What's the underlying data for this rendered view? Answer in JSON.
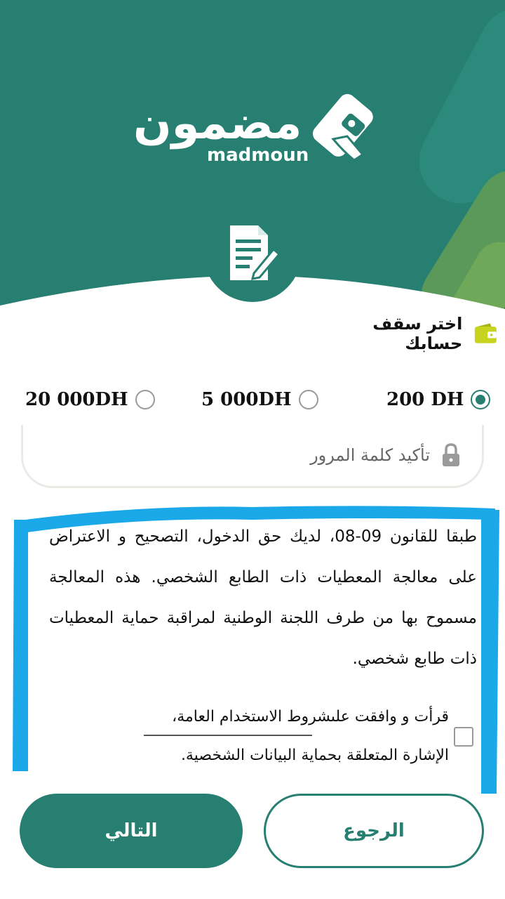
{
  "brand": {
    "name_ar": "مضمون",
    "name_en": "madmoun"
  },
  "plafond": {
    "title": "اختر سقف حسابك",
    "icon": "wallet-icon",
    "options": [
      {
        "label": "200 DH",
        "selected": true
      },
      {
        "label": "5 000DH",
        "selected": false
      },
      {
        "label": "20 000DH",
        "selected": false
      }
    ]
  },
  "password_confirm": {
    "placeholder": "تأكيد كلمة المرور",
    "icon": "lock-icon"
  },
  "legal_notice": "طبقا للقانون 09-08، لديك حق الدخول، التصحيح و الاعتراض على معالجة المعطيات ذات الطابع الشخصي. هذه المعالجة مسموح بها من طرف اللجنة الوطنية لمراقبة حماية المعطيات ذات طابع شخصي.",
  "consent": {
    "line1": "قرأت و وافقت علىشروط الاستخدام العامة،",
    "line2": "الإشارة المتعلقة بحماية البيانات الشخصية.",
    "checked": false
  },
  "buttons": {
    "next": "التالي",
    "back": "الرجوع"
  },
  "colors": {
    "primary": "#277f72",
    "accent_green": "#5d9b57",
    "highlight_blue": "#1aa8e8",
    "wallet_yellow": "#c8d31f"
  }
}
